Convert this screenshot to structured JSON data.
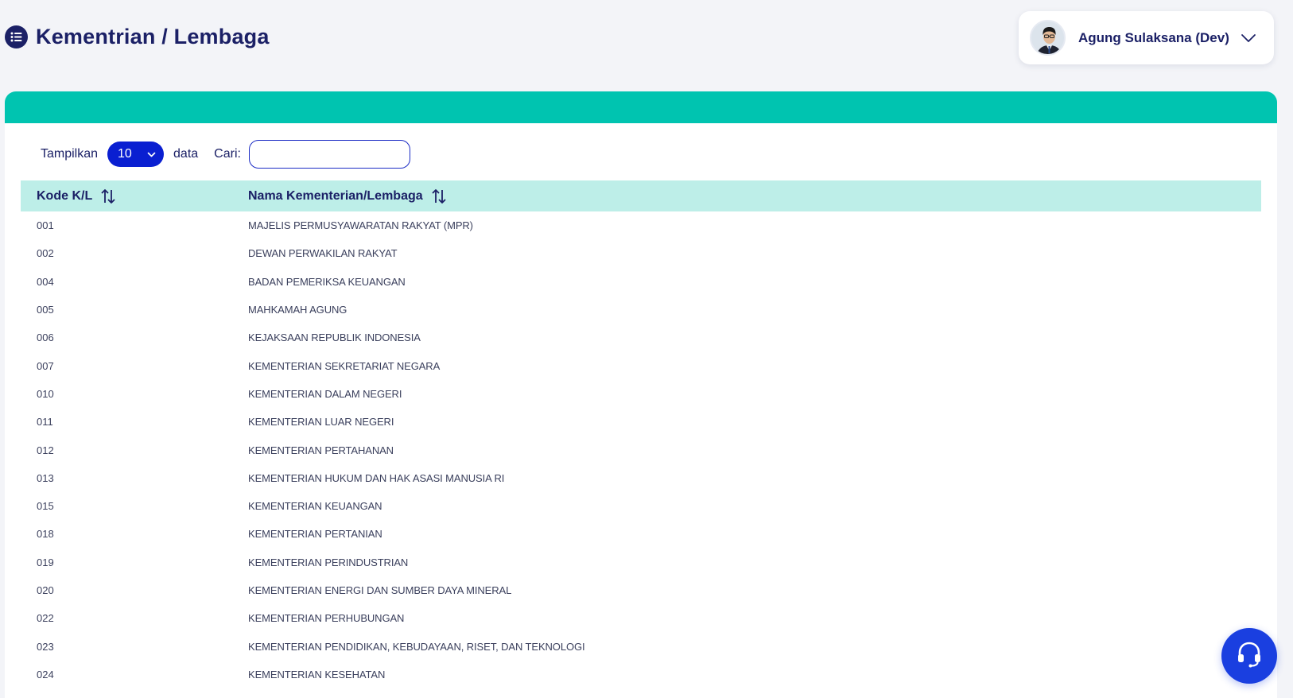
{
  "header": {
    "title": "Kementrian / Lembaga",
    "title_icon": "list-icon",
    "user": {
      "name": "Agung Sulaksana (Dev)",
      "avatar_icon": "user-avatar",
      "menu_icon": "chevron-down-icon"
    }
  },
  "theme": {
    "primary": "#1b2066",
    "accent_teal": "#00c4b0",
    "header_row": "#bdeee8",
    "select_bg": "#0a1fd1",
    "fab_bg": "#1a3fe0"
  },
  "controls": {
    "length_label": "Tampilkan",
    "length_value": "10",
    "length_suffix": "data",
    "search_label": "Cari:",
    "search_value": ""
  },
  "table": {
    "columns": [
      "Kode K/L",
      "Nama Kementerian/Lembaga"
    ],
    "rows": [
      {
        "code": "001",
        "name": "MAJELIS PERMUSYAWARATAN RAKYAT (MPR)"
      },
      {
        "code": "002",
        "name": "DEWAN PERWAKILAN RAKYAT"
      },
      {
        "code": "004",
        "name": "BADAN PEMERIKSA KEUANGAN"
      },
      {
        "code": "005",
        "name": "MAHKAMAH AGUNG"
      },
      {
        "code": "006",
        "name": "KEJAKSAAN REPUBLIK INDONESIA"
      },
      {
        "code": "007",
        "name": "KEMENTERIAN SEKRETARIAT NEGARA"
      },
      {
        "code": "010",
        "name": "KEMENTERIAN DALAM NEGERI"
      },
      {
        "code": "011",
        "name": "KEMENTERIAN LUAR NEGERI"
      },
      {
        "code": "012",
        "name": "KEMENTERIAN PERTAHANAN"
      },
      {
        "code": "013",
        "name": "KEMENTERIAN HUKUM DAN HAK ASASI MANUSIA RI"
      },
      {
        "code": "015",
        "name": "KEMENTERIAN KEUANGAN"
      },
      {
        "code": "018",
        "name": "KEMENTERIAN PERTANIAN"
      },
      {
        "code": "019",
        "name": "KEMENTERIAN PERINDUSTRIAN"
      },
      {
        "code": "020",
        "name": "KEMENTERIAN ENERGI DAN SUMBER DAYA MINERAL"
      },
      {
        "code": "022",
        "name": "KEMENTERIAN PERHUBUNGAN"
      },
      {
        "code": "023",
        "name": "KEMENTERIAN PENDIDIKAN, KEBUDAYAAN, RISET, DAN TEKNOLOGI"
      },
      {
        "code": "024",
        "name": "KEMENTERIAN KESEHATAN"
      }
    ]
  },
  "fab": {
    "icon": "headset-support-icon"
  }
}
